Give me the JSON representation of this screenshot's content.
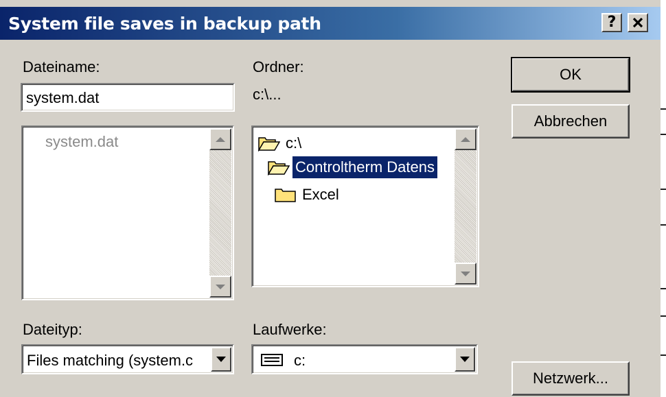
{
  "window": {
    "title": "System file saves in backup path",
    "help_label": "?",
    "close_label": "✕"
  },
  "file_name": {
    "label": "Dateiname:",
    "value": "system.dat",
    "list": [
      "system.dat"
    ]
  },
  "folder": {
    "label": "Ordner:",
    "current_path": "c:\\...",
    "tree": [
      {
        "label": "c:\\",
        "icon": "open-folder-icon",
        "selected": false
      },
      {
        "label": "Controltherm Datens",
        "icon": "open-folder-icon",
        "selected": true
      },
      {
        "label": "Excel",
        "icon": "folder-icon",
        "selected": false
      }
    ]
  },
  "buttons": {
    "ok": "OK",
    "cancel": "Abbrechen",
    "network": "Netzwerk..."
  },
  "file_type": {
    "label": "Dateityp:",
    "selected": "Files matching (system.c"
  },
  "drives": {
    "label": "Laufwerke:",
    "selected": "c:",
    "icon": "drive-icon"
  },
  "colors": {
    "title_gradient_start": "#0a246a",
    "title_gradient_end": "#a6caf0",
    "selection": "#0a246a",
    "dialog_bg": "#d4d0c8",
    "folder_yellow": "#ffe27a"
  }
}
